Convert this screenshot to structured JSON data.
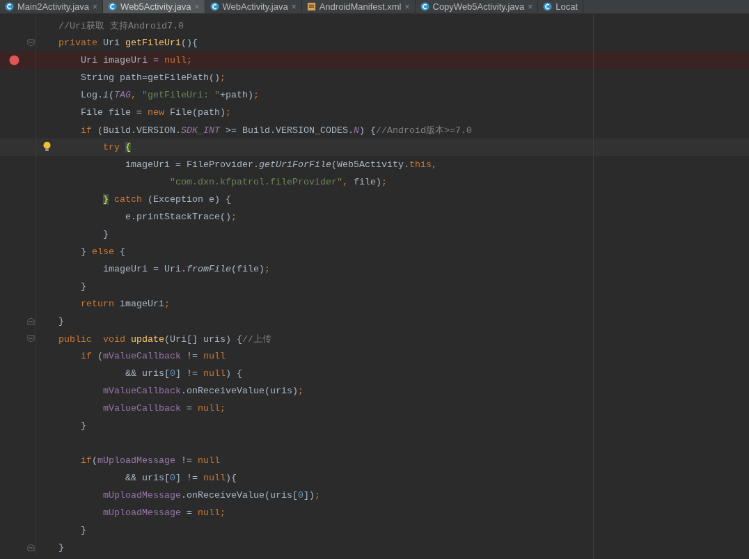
{
  "tabs": [
    {
      "label": "Main2Activity.java",
      "kind": "java",
      "close": "×",
      "selected": false
    },
    {
      "label": "Web5Activity.java",
      "kind": "java",
      "close": "×",
      "selected": true
    },
    {
      "label": "WebActivity.java",
      "kind": "java",
      "close": "×",
      "selected": false
    },
    {
      "label": "AndroidManifest.xml",
      "kind": "xml",
      "close": "×",
      "selected": false
    },
    {
      "label": "CopyWeb5Activity.java",
      "kind": "java",
      "close": "×",
      "selected": false
    },
    {
      "label": "Locat",
      "kind": "java",
      "selected": false
    }
  ],
  "lines": [
    {
      "kind": "code",
      "tokens": [
        {
          "kind": "cmt",
          "text": "//Uri获取 支持Android7.0"
        }
      ]
    },
    {
      "kind": "code",
      "fold_start": true,
      "tokens": [
        {
          "kind": "kw",
          "text": "private "
        },
        {
          "kind": "p",
          "text": "Uri "
        },
        {
          "kind": "decl",
          "text": "getFileUri"
        },
        {
          "kind": "p",
          "text": "(){"
        }
      ],
      "children": [
        {
          "kind": "code",
          "breakpoint": true,
          "tokens": [
            {
              "kind": "p",
              "text": "Uri imageUri = "
            },
            {
              "kind": "kw",
              "text": "null;"
            }
          ]
        },
        {
          "kind": "code",
          "tokens": [
            {
              "kind": "p",
              "text": "String path=getFilePath()"
            },
            {
              "kind": "kw",
              "text": ";"
            }
          ]
        },
        {
          "kind": "code",
          "tokens": [
            {
              "kind": "p",
              "text": "Log."
            },
            {
              "kind": "it",
              "text": "i"
            },
            {
              "kind": "p",
              "text": "("
            },
            {
              "kind": "st",
              "text": "TAG"
            },
            {
              "kind": "kw",
              "text": ", "
            },
            {
              "kind": "str",
              "text": "\"getFileUri: \""
            },
            {
              "kind": "p",
              "text": "+path)"
            },
            {
              "kind": "kw",
              "text": ";"
            }
          ]
        },
        {
          "kind": "code",
          "tokens": [
            {
              "kind": "p",
              "text": "File file = "
            },
            {
              "kind": "kw",
              "text": "new "
            },
            {
              "kind": "p",
              "text": "File(path)"
            },
            {
              "kind": "kw",
              "text": ";"
            }
          ]
        },
        {
          "kind": "code",
          "tokens": [
            {
              "kind": "kw",
              "text": "if "
            },
            {
              "kind": "p",
              "text": "(Build.VERSION."
            },
            {
              "kind": "st",
              "text": "SDK_INT"
            },
            {
              "kind": "p",
              "text": " >= Build.VERSION_CODES."
            },
            {
              "kind": "st",
              "text": "N"
            },
            {
              "kind": "p",
              "text": ") {"
            },
            {
              "kind": "cmt",
              "text": "//Android版本>=7.0"
            }
          ],
          "children": [
            {
              "kind": "code",
              "bulb": true,
              "caret": true,
              "tokens": [
                {
                  "kind": "kw",
                  "text": "try "
                },
                {
                  "kind": "brace",
                  "text": "{"
                }
              ],
              "children": [
                {
                  "kind": "code",
                  "tokens": [
                    {
                      "kind": "p",
                      "text": "imageUri = FileProvider."
                    },
                    {
                      "kind": "it",
                      "text": "getUriForFile"
                    },
                    {
                      "kind": "p",
                      "text": "(Web5Activity."
                    },
                    {
                      "kind": "kw",
                      "text": "this,"
                    }
                  ],
                  "children": [
                    {
                      "kind": "cont",
                      "tokens": [
                        {
                          "kind": "str",
                          "text": "\"com.dxn.kfpatrol.fileProvider\""
                        },
                        {
                          "kind": "kw",
                          "text": ", "
                        },
                        {
                          "kind": "p",
                          "text": "file)"
                        },
                        {
                          "kind": "kw",
                          "text": ";"
                        }
                      ]
                    }
                  ]
                }
              ]
            },
            {
              "kind": "code",
              "tokens": [
                {
                  "kind": "brace",
                  "text": "}"
                },
                {
                  "kind": "kw",
                  "text": " catch "
                },
                {
                  "kind": "p",
                  "text": "(Exception e) {"
                }
              ],
              "children": [
                {
                  "kind": "code",
                  "tokens": [
                    {
                      "kind": "p",
                      "text": "e.printStackTrace()"
                    },
                    {
                      "kind": "kw",
                      "text": ";"
                    }
                  ]
                }
              ]
            },
            {
              "kind": "code",
              "tokens": [
                {
                  "kind": "p",
                  "text": "}"
                }
              ]
            }
          ]
        },
        {
          "kind": "code",
          "tokens": [
            {
              "kind": "p",
              "text": "} "
            },
            {
              "kind": "kw",
              "text": "else "
            },
            {
              "kind": "p",
              "text": "{"
            }
          ],
          "children": [
            {
              "kind": "code",
              "tokens": [
                {
                  "kind": "p",
                  "text": "imageUri = Uri."
                },
                {
                  "kind": "it",
                  "text": "fromFile"
                },
                {
                  "kind": "p",
                  "text": "(file)"
                },
                {
                  "kind": "kw",
                  "text": ";"
                }
              ]
            }
          ]
        },
        {
          "kind": "code",
          "tokens": [
            {
              "kind": "p",
              "text": "}"
            }
          ]
        },
        {
          "kind": "code",
          "tokens": [
            {
              "kind": "kw",
              "text": "return "
            },
            {
              "kind": "p",
              "text": "imageUri"
            },
            {
              "kind": "kw",
              "text": ";"
            }
          ]
        }
      ]
    },
    {
      "kind": "code",
      "fold_end": true,
      "tokens": [
        {
          "kind": "p",
          "text": "}"
        }
      ]
    },
    {
      "kind": "code",
      "fold_start": true,
      "tokens": [
        {
          "kind": "kw",
          "text": "public  void "
        },
        {
          "kind": "decl",
          "text": "update"
        },
        {
          "kind": "p",
          "text": "(Uri[] uris) {"
        },
        {
          "kind": "cmt",
          "text": "//上传"
        }
      ],
      "children": [
        {
          "kind": "code",
          "tokens": [
            {
              "kind": "kw",
              "text": "if "
            },
            {
              "kind": "p",
              "text": "("
            },
            {
              "kind": "fld",
              "text": "mValueCallback"
            },
            {
              "kind": "p",
              "text": " != "
            },
            {
              "kind": "kw",
              "text": "null"
            }
          ],
          "children": [
            {
              "kind": "cont",
              "tokens": [
                {
                  "kind": "p",
                  "text": "&& uris["
                },
                {
                  "kind": "num",
                  "text": "0"
                },
                {
                  "kind": "p",
                  "text": "] != "
                },
                {
                  "kind": "kw",
                  "text": "null"
                },
                {
                  "kind": "p",
                  "text": ") {"
                }
              ]
            },
            {
              "kind": "code",
              "tokens": [
                {
                  "kind": "fld",
                  "text": "mValueCallback"
                },
                {
                  "kind": "p",
                  "text": ".onReceiveValue(uris)"
                },
                {
                  "kind": "kw",
                  "text": ";"
                }
              ]
            },
            {
              "kind": "code",
              "tokens": [
                {
                  "kind": "fld",
                  "text": "mValueCallback"
                },
                {
                  "kind": "p",
                  "text": " = "
                },
                {
                  "kind": "kw",
                  "text": "null;"
                }
              ]
            }
          ]
        },
        {
          "kind": "code",
          "tokens": [
            {
              "kind": "p",
              "text": "}"
            }
          ]
        },
        {
          "kind": "blank"
        },
        {
          "kind": "code",
          "tokens": [
            {
              "kind": "kw",
              "text": "if"
            },
            {
              "kind": "p",
              "text": "("
            },
            {
              "kind": "fld",
              "text": "mUploadMessage"
            },
            {
              "kind": "p",
              "text": " != "
            },
            {
              "kind": "kw",
              "text": "null"
            }
          ],
          "children": [
            {
              "kind": "cont",
              "tokens": [
                {
                  "kind": "p",
                  "text": "&& uris["
                },
                {
                  "kind": "num",
                  "text": "0"
                },
                {
                  "kind": "p",
                  "text": "] != "
                },
                {
                  "kind": "kw",
                  "text": "null"
                },
                {
                  "kind": "p",
                  "text": "){"
                }
              ]
            },
            {
              "kind": "code",
              "tokens": [
                {
                  "kind": "fld",
                  "text": "mUploadMessage"
                },
                {
                  "kind": "p",
                  "text": ".onReceiveValue(uris["
                },
                {
                  "kind": "num",
                  "text": "0"
                },
                {
                  "kind": "p",
                  "text": "])"
                },
                {
                  "kind": "kw",
                  "text": ";"
                }
              ]
            },
            {
              "kind": "code",
              "tokens": [
                {
                  "kind": "fld",
                  "text": "mUploadMessage"
                },
                {
                  "kind": "p",
                  "text": " = "
                },
                {
                  "kind": "kw",
                  "text": "null;"
                }
              ]
            }
          ]
        },
        {
          "kind": "code",
          "tokens": [
            {
              "kind": "p",
              "text": "}"
            }
          ]
        }
      ]
    },
    {
      "kind": "code",
      "fold_end": true,
      "tokens": [
        {
          "kind": "p",
          "text": "}"
        }
      ]
    }
  ]
}
